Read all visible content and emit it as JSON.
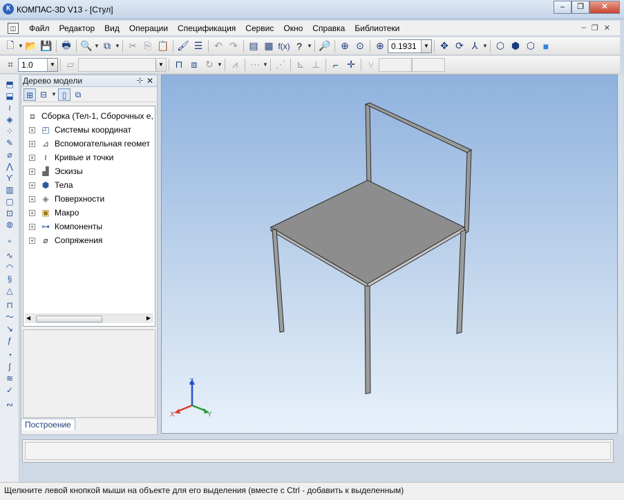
{
  "window": {
    "logo": "К",
    "title": "КОМПАС-3D V13 - [Стул]",
    "minimize": "‒",
    "restore": "❐",
    "close": "✕"
  },
  "menubar": {
    "items": [
      "Файл",
      "Редактор",
      "Вид",
      "Операции",
      "Спецификация",
      "Сервис",
      "Окно",
      "Справка",
      "Библиотеки"
    ],
    "mdi_minimize": "‒",
    "mdi_restore": "❐",
    "mdi_close": "✕"
  },
  "toolbar": {
    "zoom_value": "0.1931",
    "step_value": "1.0",
    "angle_value": ""
  },
  "tree": {
    "header": "Дерево модели",
    "pin": "⊹",
    "close": "✕",
    "root": "Сборка (Тел-1, Сборочных е,",
    "items": [
      {
        "label": "Системы координат",
        "icon": "coordinate-systems-icon"
      },
      {
        "label": "Вспомогательная геомет",
        "icon": "auxiliary-geometry-icon"
      },
      {
        "label": "Кривые и точки",
        "icon": "curves-points-icon"
      },
      {
        "label": "Эскизы",
        "icon": "sketches-icon"
      },
      {
        "label": "Тела",
        "icon": "bodies-icon"
      },
      {
        "label": "Поверхности",
        "icon": "surfaces-icon"
      },
      {
        "label": "Макро",
        "icon": "macro-icon"
      },
      {
        "label": "Компоненты",
        "icon": "components-icon"
      },
      {
        "label": "Сопряжения",
        "icon": "mates-icon"
      }
    ],
    "tab": "Построение"
  },
  "viewport": {
    "axis_x": "X",
    "axis_y": "Y",
    "axis_z": "Z",
    "colors": {
      "x": "#e03a2a",
      "y": "#2a9a3a",
      "z": "#2a4fd0"
    }
  },
  "status": {
    "text": "Щелкните левой кнопкой мыши на объекте для его выделения (вместе с Ctrl - добавить к выделенным)"
  }
}
